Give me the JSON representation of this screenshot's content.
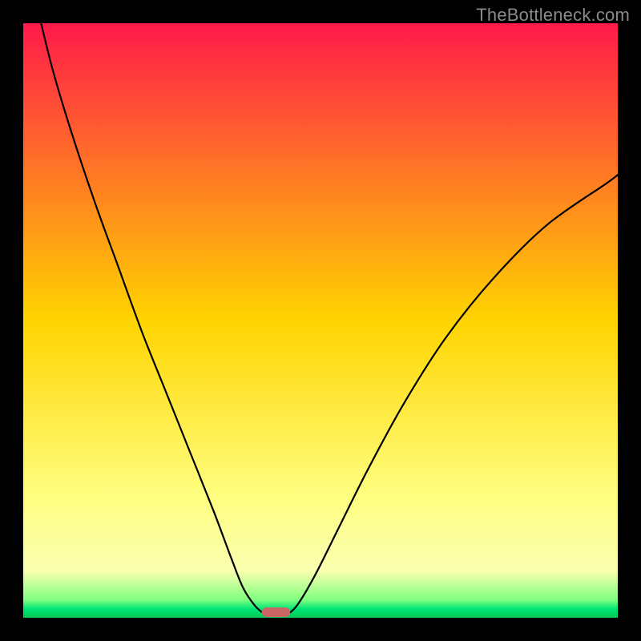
{
  "watermark": "TheBottleneck.com",
  "chart_data": {
    "type": "line",
    "title": "",
    "xlabel": "",
    "ylabel": "",
    "xlim": [
      0,
      100
    ],
    "ylim": [
      0,
      100
    ],
    "grid": false,
    "legend": false,
    "background_gradient": {
      "stops": [
        {
          "offset": 0.0,
          "color": "#ff1a4a"
        },
        {
          "offset": 0.5,
          "color": "#ffd400"
        },
        {
          "offset": 0.8,
          "color": "#ffff82"
        },
        {
          "offset": 0.92,
          "color": "#fbffb0"
        },
        {
          "offset": 0.97,
          "color": "#7fff7f"
        },
        {
          "offset": 0.985,
          "color": "#00e676"
        },
        {
          "offset": 1.0,
          "color": "#00c853"
        }
      ]
    },
    "series": [
      {
        "name": "left-curve",
        "x": [
          3,
          5,
          8,
          12,
          16,
          20,
          24,
          28,
          32,
          35,
          37,
          39,
          40.7
        ],
        "values": [
          100,
          92,
          82,
          70,
          59,
          48,
          38,
          28,
          18,
          10,
          5,
          2,
          0.5
        ]
      },
      {
        "name": "right-curve",
        "x": [
          44.3,
          46,
          49,
          53,
          58,
          64,
          71,
          79,
          88,
          98,
          100
        ],
        "values": [
          0.5,
          2,
          7,
          15,
          25,
          36,
          47,
          57,
          66,
          73,
          74.5
        ]
      }
    ],
    "valley_marker": {
      "shape": "rounded-rect",
      "x_center": 42.5,
      "width": 4.8,
      "height_pct": 1.6,
      "color": "#cc6666"
    }
  }
}
